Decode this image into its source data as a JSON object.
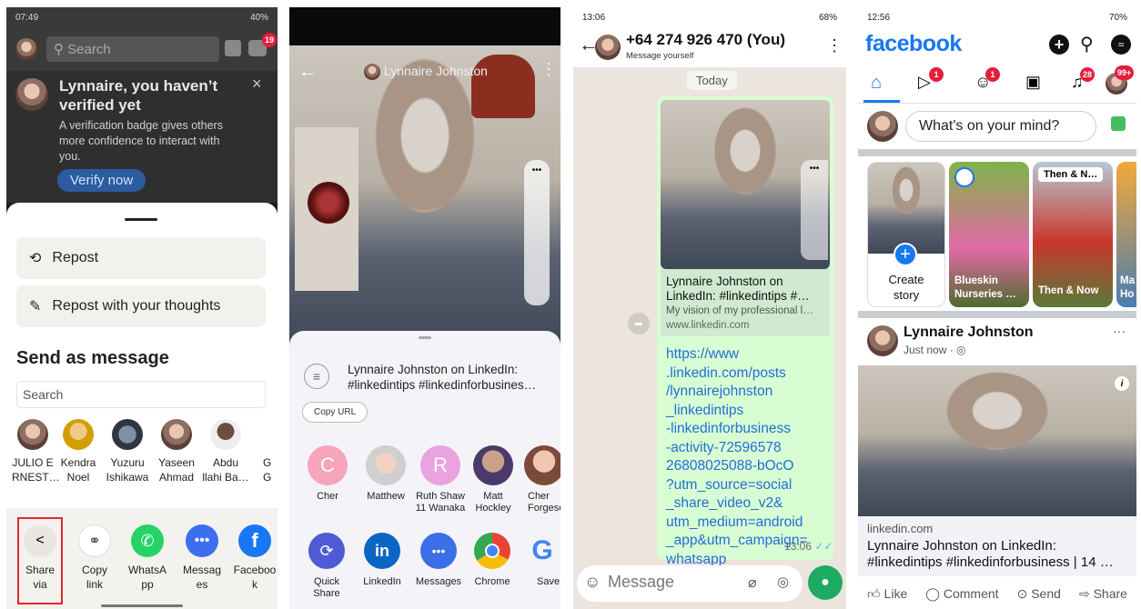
{
  "p1": {
    "status_time": "07:49",
    "status_right": "40%",
    "search_placeholder": "Search",
    "notif_count": "19",
    "verify_title": "Lynnaire, you haven’t verified yet",
    "verify_body": "A verification badge gives others more confidence to interact with you.",
    "verify_button": "Verify now",
    "close": "×",
    "repost": "Repost",
    "repost_thoughts": "Repost with your thoughts",
    "send_as_message": "Send as message",
    "search_field": "Search",
    "contacts": [
      {
        "l1": "JULIO E",
        "l2": "RNEST…"
      },
      {
        "l1": "Kendra",
        "l2": "Noel"
      },
      {
        "l1": "Yuzuru",
        "l2": "Ishikawa"
      },
      {
        "l1": "Yaseen",
        "l2": "Ahmad"
      },
      {
        "l1": "Abdu",
        "l2": "llahi Ba…"
      },
      {
        "l1": "G",
        "l2": "G"
      }
    ],
    "actions": [
      {
        "l1": "Share",
        "l2": "via",
        "icon": "share-icon"
      },
      {
        "l1": "Copy",
        "l2": "link",
        "icon": "link-icon"
      },
      {
        "l1": "WhatsA",
        "l2": "pp",
        "icon": "whatsapp-icon"
      },
      {
        "l1": "Messag",
        "l2": "es",
        "icon": "messages-icon"
      },
      {
        "l1": "Faceboo",
        "l2": "k",
        "icon": "facebook-icon"
      }
    ]
  },
  "p2": {
    "back": "←",
    "author": "Lynnaire Johnston",
    "more": "⋮",
    "more_h": "•••",
    "share_title": "Lynnaire Johnston on LinkedIn: #linkedintips #linkedinforbusines…",
    "copy_url": "Copy URL",
    "contacts": [
      {
        "l1": "Cher",
        "l2": "",
        "letter": "C"
      },
      {
        "l1": "Matthew",
        "l2": "",
        "letter": ""
      },
      {
        "l1": "Ruth Shaw",
        "l2": "11 Wanaka",
        "letter": "R"
      },
      {
        "l1": "Matt",
        "l2": "Hockley",
        "letter": ""
      },
      {
        "l1": "Cher",
        "l2": "Forgesc",
        "letter": ""
      }
    ],
    "apps": [
      {
        "l1": "Quick",
        "l2": "Share"
      },
      {
        "l1": "LinkedIn",
        "l2": ""
      },
      {
        "l1": "Messages",
        "l2": ""
      },
      {
        "l1": "Chrome",
        "l2": ""
      },
      {
        "l1": "Save",
        "l2": ""
      }
    ]
  },
  "p3": {
    "status_time": "13:06",
    "status_right": "68%",
    "contact": "+64 274 926 470 (You)",
    "subtitle": "Message yourself",
    "date": "Today",
    "link_title": "Lynnaire Johnston on LinkedIn: #linkedintips #…",
    "link_desc": "My vision of my professional l…",
    "link_domain": "www.linkedin.com",
    "url_text": "https://www.linkedin.com/posts/lynnairejohnston_linkedintips-linkedinforbusiness-activity-7259657826808025088-bOcO?utm_source=social_share_video_v2&utm_medium=android_app&utm_campaign=whatsapp",
    "url_lines": [
      "https://www",
      ".linkedin.com/posts",
      "/lynnairejohnston",
      "_linkedintips",
      "-linkedinforbusiness",
      "-activity-72596578",
      "26808025088-bOcO",
      "?utm_source=social",
      "_share_video_v2&",
      "utm_medium=android",
      "_app&utm_campaign=",
      "whatsapp"
    ],
    "time": "13:06",
    "message_placeholder": "Message"
  },
  "p4": {
    "status_time": "12:56",
    "status_right": "70%",
    "logo": "facebook",
    "badges": {
      "video": "1",
      "friends": "1",
      "notif": "28",
      "menu": "99+"
    },
    "whats_on_mind": "What's on your mind?",
    "stories": [
      {
        "l1": "Create",
        "l2": "story"
      },
      {
        "l1": "Blueskin",
        "l2": "Nurseries …"
      },
      {
        "l1": "Then & Now",
        "l2": ""
      },
      {
        "l1": "Ma",
        "l2": "Ho"
      }
    ],
    "story_top": "Then & N…",
    "post_author": "Lynnaire Johnston",
    "post_time": "Just now ·",
    "link_domain": "linkedin.com",
    "link_title": "Lynnaire Johnston on LinkedIn: #linkedintips #linkedinforbusiness | 14 …",
    "actions": [
      "Like",
      "Comment",
      "Send",
      "Share"
    ],
    "more": "···"
  }
}
